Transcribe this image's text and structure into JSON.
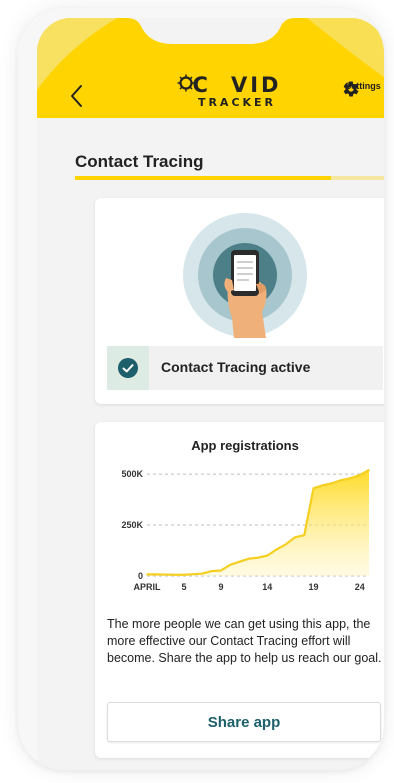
{
  "header": {
    "logo_main": "COVID",
    "logo_sub": "TRACKER",
    "settings_label": "Settings",
    "accent_color": "#ffd400"
  },
  "page": {
    "title": "Contact Tracing",
    "title_progress": 0.8
  },
  "contact_tracing_card": {
    "status_text": "Contact Tracing active",
    "status_color": "#1d5f6a"
  },
  "registrations_card": {
    "chart_title": "App registrations",
    "description": "The more people we can get using this app, the more effective our Contact Tracing effort will become. Share the app to help us reach our goal.",
    "share_label": "Share app"
  },
  "chart_data": {
    "type": "area",
    "title": "App registrations",
    "x": [
      1,
      2,
      3,
      4,
      5,
      6,
      7,
      8,
      9,
      10,
      11,
      12,
      13,
      14,
      15,
      16,
      17,
      18,
      19,
      20,
      21,
      22,
      23,
      24,
      25
    ],
    "y": [
      8000,
      8000,
      7000,
      6000,
      6000,
      9000,
      12000,
      24000,
      27000,
      55000,
      70000,
      85000,
      90000,
      100000,
      130000,
      155000,
      190000,
      200000,
      430000,
      445000,
      455000,
      470000,
      480000,
      495000,
      520000
    ],
    "xticks": [
      1,
      5,
      9,
      14,
      19,
      24
    ],
    "xtick_labels": [
      "APRIL",
      "5",
      "9",
      "14",
      "19",
      "24"
    ],
    "yticks": [
      0,
      250000,
      500000
    ],
    "ytick_labels": [
      "0",
      "250K",
      "500K"
    ],
    "xlim": [
      1,
      25
    ],
    "ylim": [
      0,
      520000
    ],
    "grid": "dashed-horizontal",
    "line_color": "#f5cf21"
  }
}
